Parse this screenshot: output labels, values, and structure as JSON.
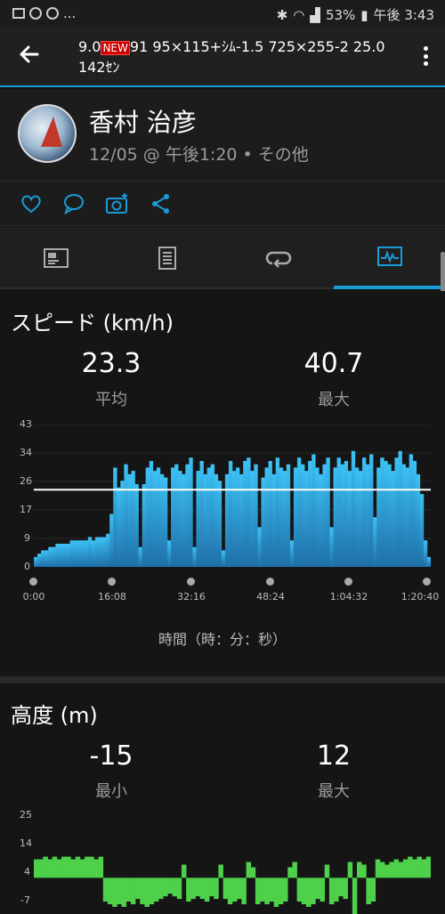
{
  "status_bar": {
    "battery": "53%",
    "time": "午後 3:43",
    "dots": "..."
  },
  "header": {
    "title_a": "9.0",
    "new_badge": "NEW",
    "title_b": "91 95×115+ｼﾑ-1.5 725×255-2 25.0",
    "title_line2": "142ｾﾝ"
  },
  "profile": {
    "name": "香村 治彦",
    "meta": "12/05 @ 午後1:20 • その他"
  },
  "tabs": [
    "overview-tab",
    "details-tab",
    "laps-tab",
    "charts-tab"
  ],
  "speed": {
    "title": "スピード (km/h)",
    "avg_value": "23.3",
    "avg_label": "平均",
    "max_value": "40.7",
    "max_label": "最大",
    "x_axis_title": "時間（時：分：秒）"
  },
  "elevation": {
    "title": "高度 (m)",
    "min_value": "-15",
    "min_label": "最小",
    "max_value": "12",
    "max_label": "最大"
  },
  "chart_data": [
    {
      "type": "area",
      "ylim": [
        0,
        43
      ],
      "yticks": [
        "43",
        "34",
        "26",
        "17",
        "9",
        "0"
      ],
      "xticks": [
        "0:00",
        "16:08",
        "32:16",
        "48:24",
        "1:04:32",
        "1:20:40"
      ],
      "average_line": 23.3,
      "color": "#2ba5e0",
      "series": [
        {
          "values": [
            3,
            4,
            5,
            5,
            6,
            6,
            7,
            7,
            7,
            7,
            8,
            8,
            8,
            8,
            8,
            9,
            8,
            9,
            9,
            9,
            10,
            16,
            30,
            24,
            26,
            31,
            28,
            29,
            25,
            6,
            25,
            30,
            32,
            29,
            30,
            28,
            27,
            8,
            30,
            31,
            29,
            28,
            31,
            33,
            6,
            29,
            32,
            28,
            30,
            31,
            28,
            26,
            5,
            28,
            32,
            29,
            30,
            28,
            32,
            33,
            29,
            31,
            12,
            27,
            30,
            32,
            28,
            33,
            30,
            29,
            31,
            8,
            30,
            33,
            31,
            29,
            32,
            34,
            30,
            28,
            31,
            33,
            12,
            30,
            33,
            31,
            32,
            29,
            35,
            30,
            29,
            33,
            31,
            34,
            15,
            30,
            33,
            32,
            31,
            29,
            33,
            35,
            31,
            30,
            34,
            32,
            28,
            22,
            8,
            3
          ]
        }
      ]
    },
    {
      "type": "area",
      "ylim": [
        -7,
        25
      ],
      "yticks": [
        "25",
        "14",
        "4",
        "-7"
      ],
      "color": "#4fd04a",
      "series": [
        {
          "values": [
            11,
            11,
            12,
            11,
            12,
            11,
            12,
            12,
            11,
            12,
            11,
            12,
            12,
            11,
            12,
            -5,
            -6,
            -7,
            -6,
            -7,
            -5,
            -6,
            -4,
            -6,
            -7,
            -6,
            -5,
            -4,
            -3,
            -2,
            -3,
            -4,
            9,
            -5,
            -4,
            -3,
            -4,
            -5,
            -3,
            -4,
            9,
            -4,
            -6,
            -5,
            -4,
            -6,
            10,
            8,
            -6,
            -5,
            -6,
            -5,
            -7,
            -6,
            -5,
            8,
            10,
            -5,
            -6,
            -7,
            -6,
            -4,
            -5,
            9,
            -6,
            -5,
            -3,
            -4,
            10,
            -12,
            10,
            9,
            -6,
            -5,
            11,
            10,
            9,
            10,
            11,
            10,
            11,
            12,
            11,
            12,
            11,
            12
          ]
        }
      ]
    }
  ]
}
